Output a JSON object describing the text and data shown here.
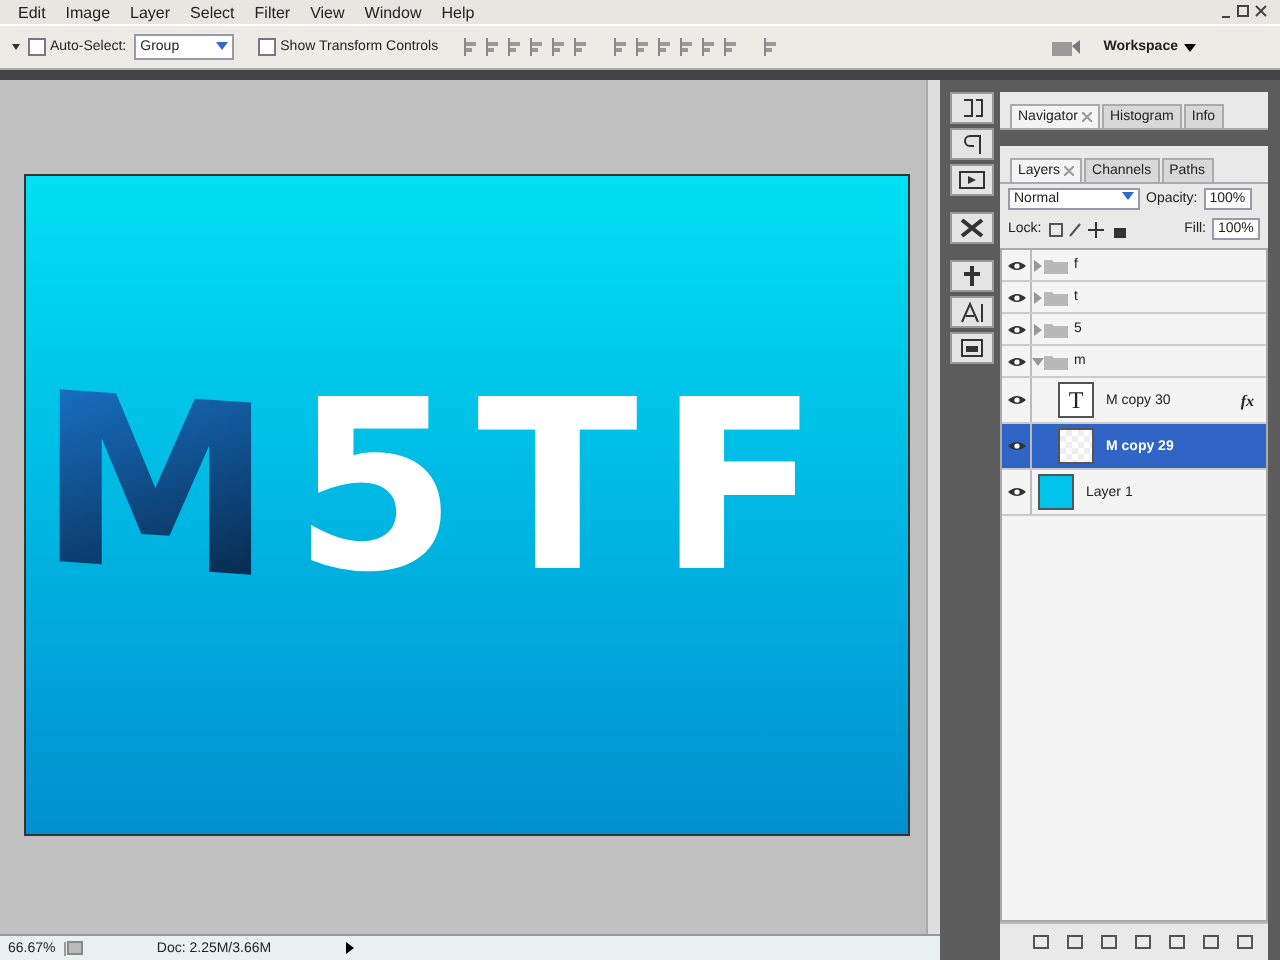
{
  "menu": [
    "Edit",
    "Image",
    "Layer",
    "Select",
    "Filter",
    "View",
    "Window",
    "Help"
  ],
  "options": {
    "auto_select": {
      "label": "Auto-Select:",
      "checked": false
    },
    "auto_select_mode": "Group",
    "show_transform": {
      "label": "Show Transform Controls",
      "checked": false
    },
    "workspace": "Workspace"
  },
  "canvas": {
    "letters": [
      {
        "text": "M",
        "kind": "gradient"
      },
      {
        "text": "5",
        "kind": "plain"
      },
      {
        "text": "T",
        "kind": "plain"
      },
      {
        "text": "F",
        "kind": "plain"
      }
    ]
  },
  "panels": {
    "top_tabs": [
      {
        "label": "Navigator",
        "selected": true,
        "closable": true
      },
      {
        "label": "Histogram",
        "selected": false,
        "closable": false
      },
      {
        "label": "Info",
        "selected": false,
        "closable": false
      }
    ],
    "layer_tabs": [
      {
        "label": "Layers",
        "selected": true,
        "closable": true
      },
      {
        "label": "Channels",
        "selected": false,
        "closable": false
      },
      {
        "label": "Paths",
        "selected": false,
        "closable": false
      }
    ],
    "blend_mode": "Normal",
    "opacity_label": "Opacity:",
    "opacity": "100%",
    "lock_label": "Lock:",
    "fill_label": "Fill:",
    "fill": "100%",
    "layers": [
      {
        "name": "f",
        "kind": "group",
        "visible": true,
        "expanded": false,
        "selected": false
      },
      {
        "name": "t",
        "kind": "group",
        "visible": true,
        "expanded": false,
        "selected": false
      },
      {
        "name": "5",
        "kind": "group",
        "visible": true,
        "expanded": false,
        "selected": false
      },
      {
        "name": "m",
        "kind": "group",
        "visible": true,
        "expanded": true,
        "selected": false,
        "children": [
          {
            "name": "M copy 30",
            "kind": "text",
            "thumb": "T",
            "fx": "fx",
            "visible": true,
            "selected": false
          },
          {
            "name": "M copy 29",
            "kind": "pixel",
            "visible": true,
            "selected": true
          }
        ]
      },
      {
        "name": "Layer 1",
        "kind": "pixel",
        "color": "#00c4ec",
        "visible": true,
        "selected": false
      }
    ]
  },
  "status": {
    "zoom": "66.67%",
    "doc": "Doc: 2.25M/3.66M"
  }
}
